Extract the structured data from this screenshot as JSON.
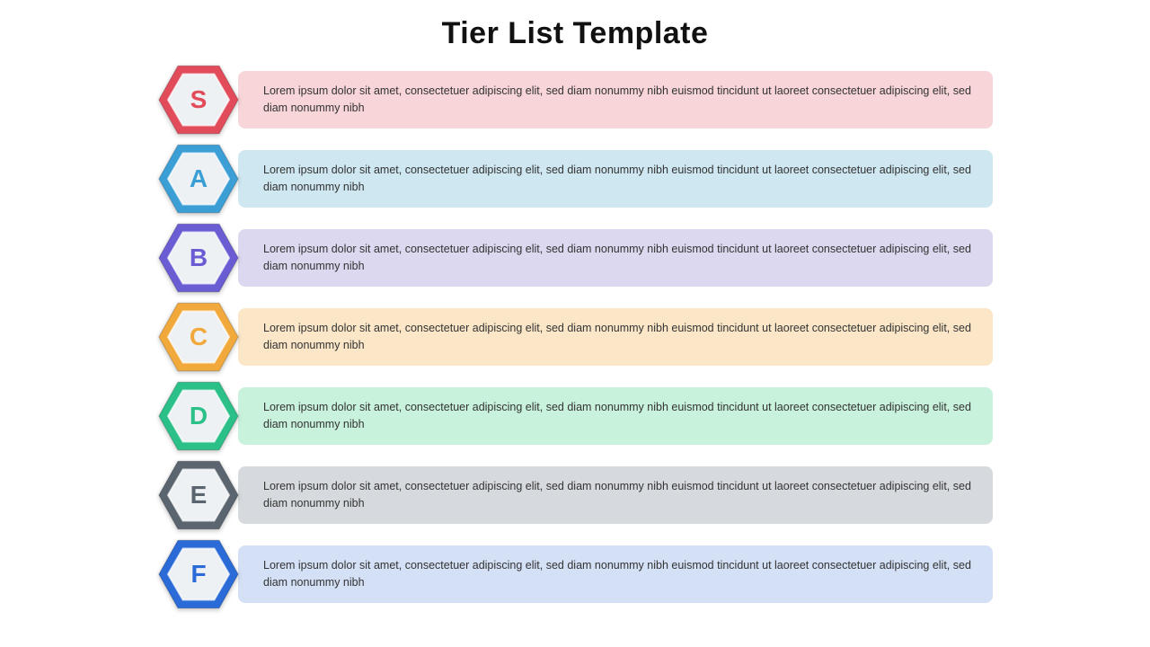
{
  "title": "Tier List Template",
  "placeholder_text": "Lorem ipsum dolor sit amet, consectetuer adipiscing elit, sed diam nonummy nibh euismod tincidunt ut laoreet consectetuer adipiscing elit, sed diam nonummy nibh",
  "tiers": [
    {
      "letter": "S",
      "hex_color": "#e14b5a",
      "letter_color": "#e14b5a",
      "bar_color": "#f7d5d9",
      "inner_fill": "#eef1f4"
    },
    {
      "letter": "A",
      "hex_color": "#3b9fd6",
      "letter_color": "#3b9fd6",
      "bar_color": "#cfe7f1",
      "inner_fill": "#eef1f4"
    },
    {
      "letter": "B",
      "hex_color": "#6a5dd4",
      "letter_color": "#6a5dd4",
      "bar_color": "#dcd8ef",
      "inner_fill": "#eef1f4"
    },
    {
      "letter": "C",
      "hex_color": "#f2a93b",
      "letter_color": "#f2a93b",
      "bar_color": "#fbe7c8",
      "inner_fill": "#eef1f4"
    },
    {
      "letter": "D",
      "hex_color": "#2bc088",
      "letter_color": "#2bc088",
      "bar_color": "#c9f2dc",
      "inner_fill": "#eef1f4"
    },
    {
      "letter": "E",
      "hex_color": "#5a6570",
      "letter_color": "#5a6570",
      "bar_color": "#d6dade",
      "inner_fill": "#eef1f4"
    },
    {
      "letter": "F",
      "hex_color": "#2a6bd8",
      "letter_color": "#2a6bd8",
      "bar_color": "#d3e0f6",
      "inner_fill": "#eef1f4"
    }
  ]
}
